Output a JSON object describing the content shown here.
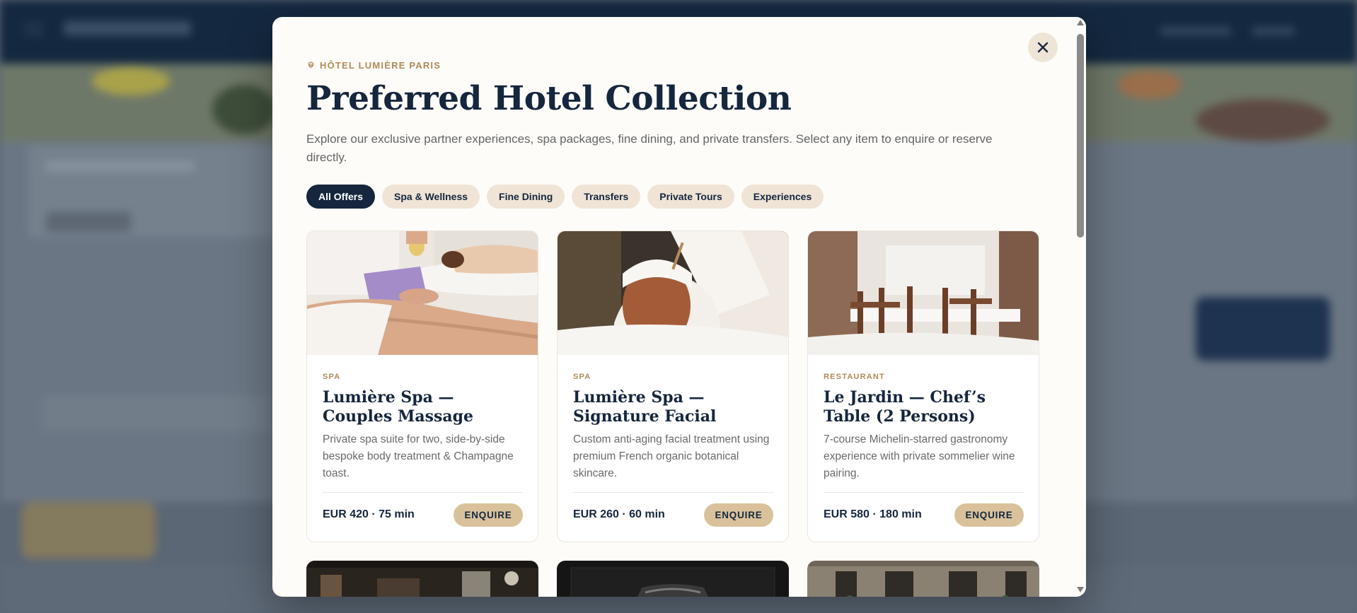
{
  "modal": {
    "brand": "HÔTEL LUMIÈRE PARIS",
    "title": "Preferred Hotel Collection",
    "description": "Explore our exclusive partner experiences, spa packages, fine dining, and private transfers. Select any item to enquire or reserve directly.",
    "close_icon": "close-icon",
    "brand_icon": "gem-icon"
  },
  "filters": [
    {
      "label": "All Offers",
      "active": true
    },
    {
      "label": "Spa & Wellness",
      "active": false
    },
    {
      "label": "Fine Dining",
      "active": false
    },
    {
      "label": "Transfers",
      "active": false
    },
    {
      "label": "Private Tours",
      "active": false
    },
    {
      "label": "Experiences",
      "active": false
    }
  ],
  "offers": [
    {
      "category": "SPA",
      "title": "Lumière Spa — Couples Massage",
      "description": "Private spa suite for two, side-by-side bespoke body treatment & Champagne toast.",
      "price": "EUR 420 · 75 min",
      "button": "ENQUIRE"
    },
    {
      "category": "SPA",
      "title": "Lumière Spa — Signature Facial",
      "description": "Custom anti-aging facial treatment using premium French organic botanical skincare.",
      "price": "EUR 260 · 60 min",
      "button": "ENQUIRE"
    },
    {
      "category": "RESTAURANT",
      "title": "Le Jardin — Chef’s Table (2 Persons)",
      "description": "7-course Michelin-starred gastronomy experience with private sommelier wine pairing.",
      "price": "EUR 580 · 180 min",
      "button": "ENQUIRE"
    }
  ],
  "colors": {
    "navy": "#15263d",
    "gold": "#b08a5a",
    "button_gold": "#d9c29b",
    "chip_bg": "#efe4d6",
    "modal_bg": "#fdfcf8"
  }
}
